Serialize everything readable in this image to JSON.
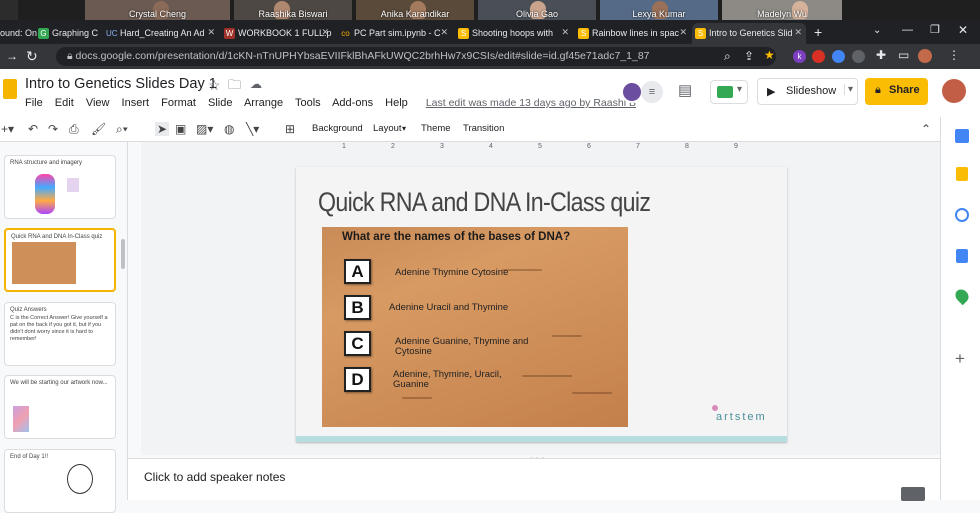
{
  "meeting": {
    "participants": [
      "Crystal Cheng",
      "Raashika Biswari",
      "Anika Karandikar",
      "Olivia Gao",
      "Lexya Kumar",
      "Madelyn Wu"
    ],
    "sound_label": "ound: On"
  },
  "tabs": [
    {
      "label": "Graphing C",
      "icon": "G"
    },
    {
      "label": "Hard_Creating An Ad",
      "icon": "UC"
    },
    {
      "label": "WORKBOOK 1 FULL.p",
      "icon": "W"
    },
    {
      "label": "PC Part sim.ipynb - C",
      "icon": "co"
    },
    {
      "label": "Shooting hoops with",
      "icon": "S"
    },
    {
      "label": "Rainbow lines in spac",
      "icon": "S"
    },
    {
      "label": "Intro to Genetics Slid",
      "icon": "S"
    }
  ],
  "browser": {
    "url": "docs.google.com/presentation/d/1cKN-nTnUPHYbsaEVIIFklBhAFkUWQC2brhHw7x9CSIs/edit#slide=id.gf45e71adc7_1_87"
  },
  "doc": {
    "title": "Intro to Genetics Slides Day 1",
    "menus": [
      "File",
      "Edit",
      "View",
      "Insert",
      "Format",
      "Slide",
      "Arrange",
      "Tools",
      "Add-ons",
      "Help"
    ],
    "last_edit": "Last edit was made 13 days ago by Raashi B",
    "slideshow_label": "Slideshow",
    "share_label": "Share"
  },
  "toolbar": {
    "background_label": "Background",
    "layout_label": "Layout",
    "theme_label": "Theme",
    "transition_label": "Transition"
  },
  "filmstrip": [
    {
      "title": "RNA structure and imagery",
      "subtitle": ""
    },
    {
      "title": "Quick RNA and DNA In-Class quiz",
      "subtitle": ""
    },
    {
      "title": "Quiz Answers",
      "subtitle": "C is the Correct Answer! Give yourself a pat on the back if you got it, but if you didn't dont worry since it is hard to remember!"
    },
    {
      "title": "We will be starting our artwork now...",
      "subtitle": ""
    },
    {
      "title": "End of Day 1!!",
      "subtitle": ""
    }
  ],
  "slide": {
    "title": "Quick RNA and DNA In-Class quiz",
    "question": "What are the names of the bases of DNA?",
    "options": [
      {
        "letter": "A",
        "text": "Adenine Thymine Cytosine"
      },
      {
        "letter": "B",
        "text": "Adenine Uracil and Thymine"
      },
      {
        "letter": "C",
        "text": "Adenine Guanine, Thymine and Cytosine"
      },
      {
        "letter": "D",
        "text": "Adenine, Thymine, Uracil, Guanine"
      }
    ],
    "logo": "artstem"
  },
  "notes": {
    "placeholder": "Click to add speaker notes"
  },
  "ruler_ticks": [
    "1",
    "2",
    "3",
    "4",
    "5",
    "6",
    "7",
    "8",
    "9"
  ],
  "colors": {
    "share": "#fbbc04",
    "selected_thumb": "#f4b400",
    "link": "#5f6368"
  }
}
